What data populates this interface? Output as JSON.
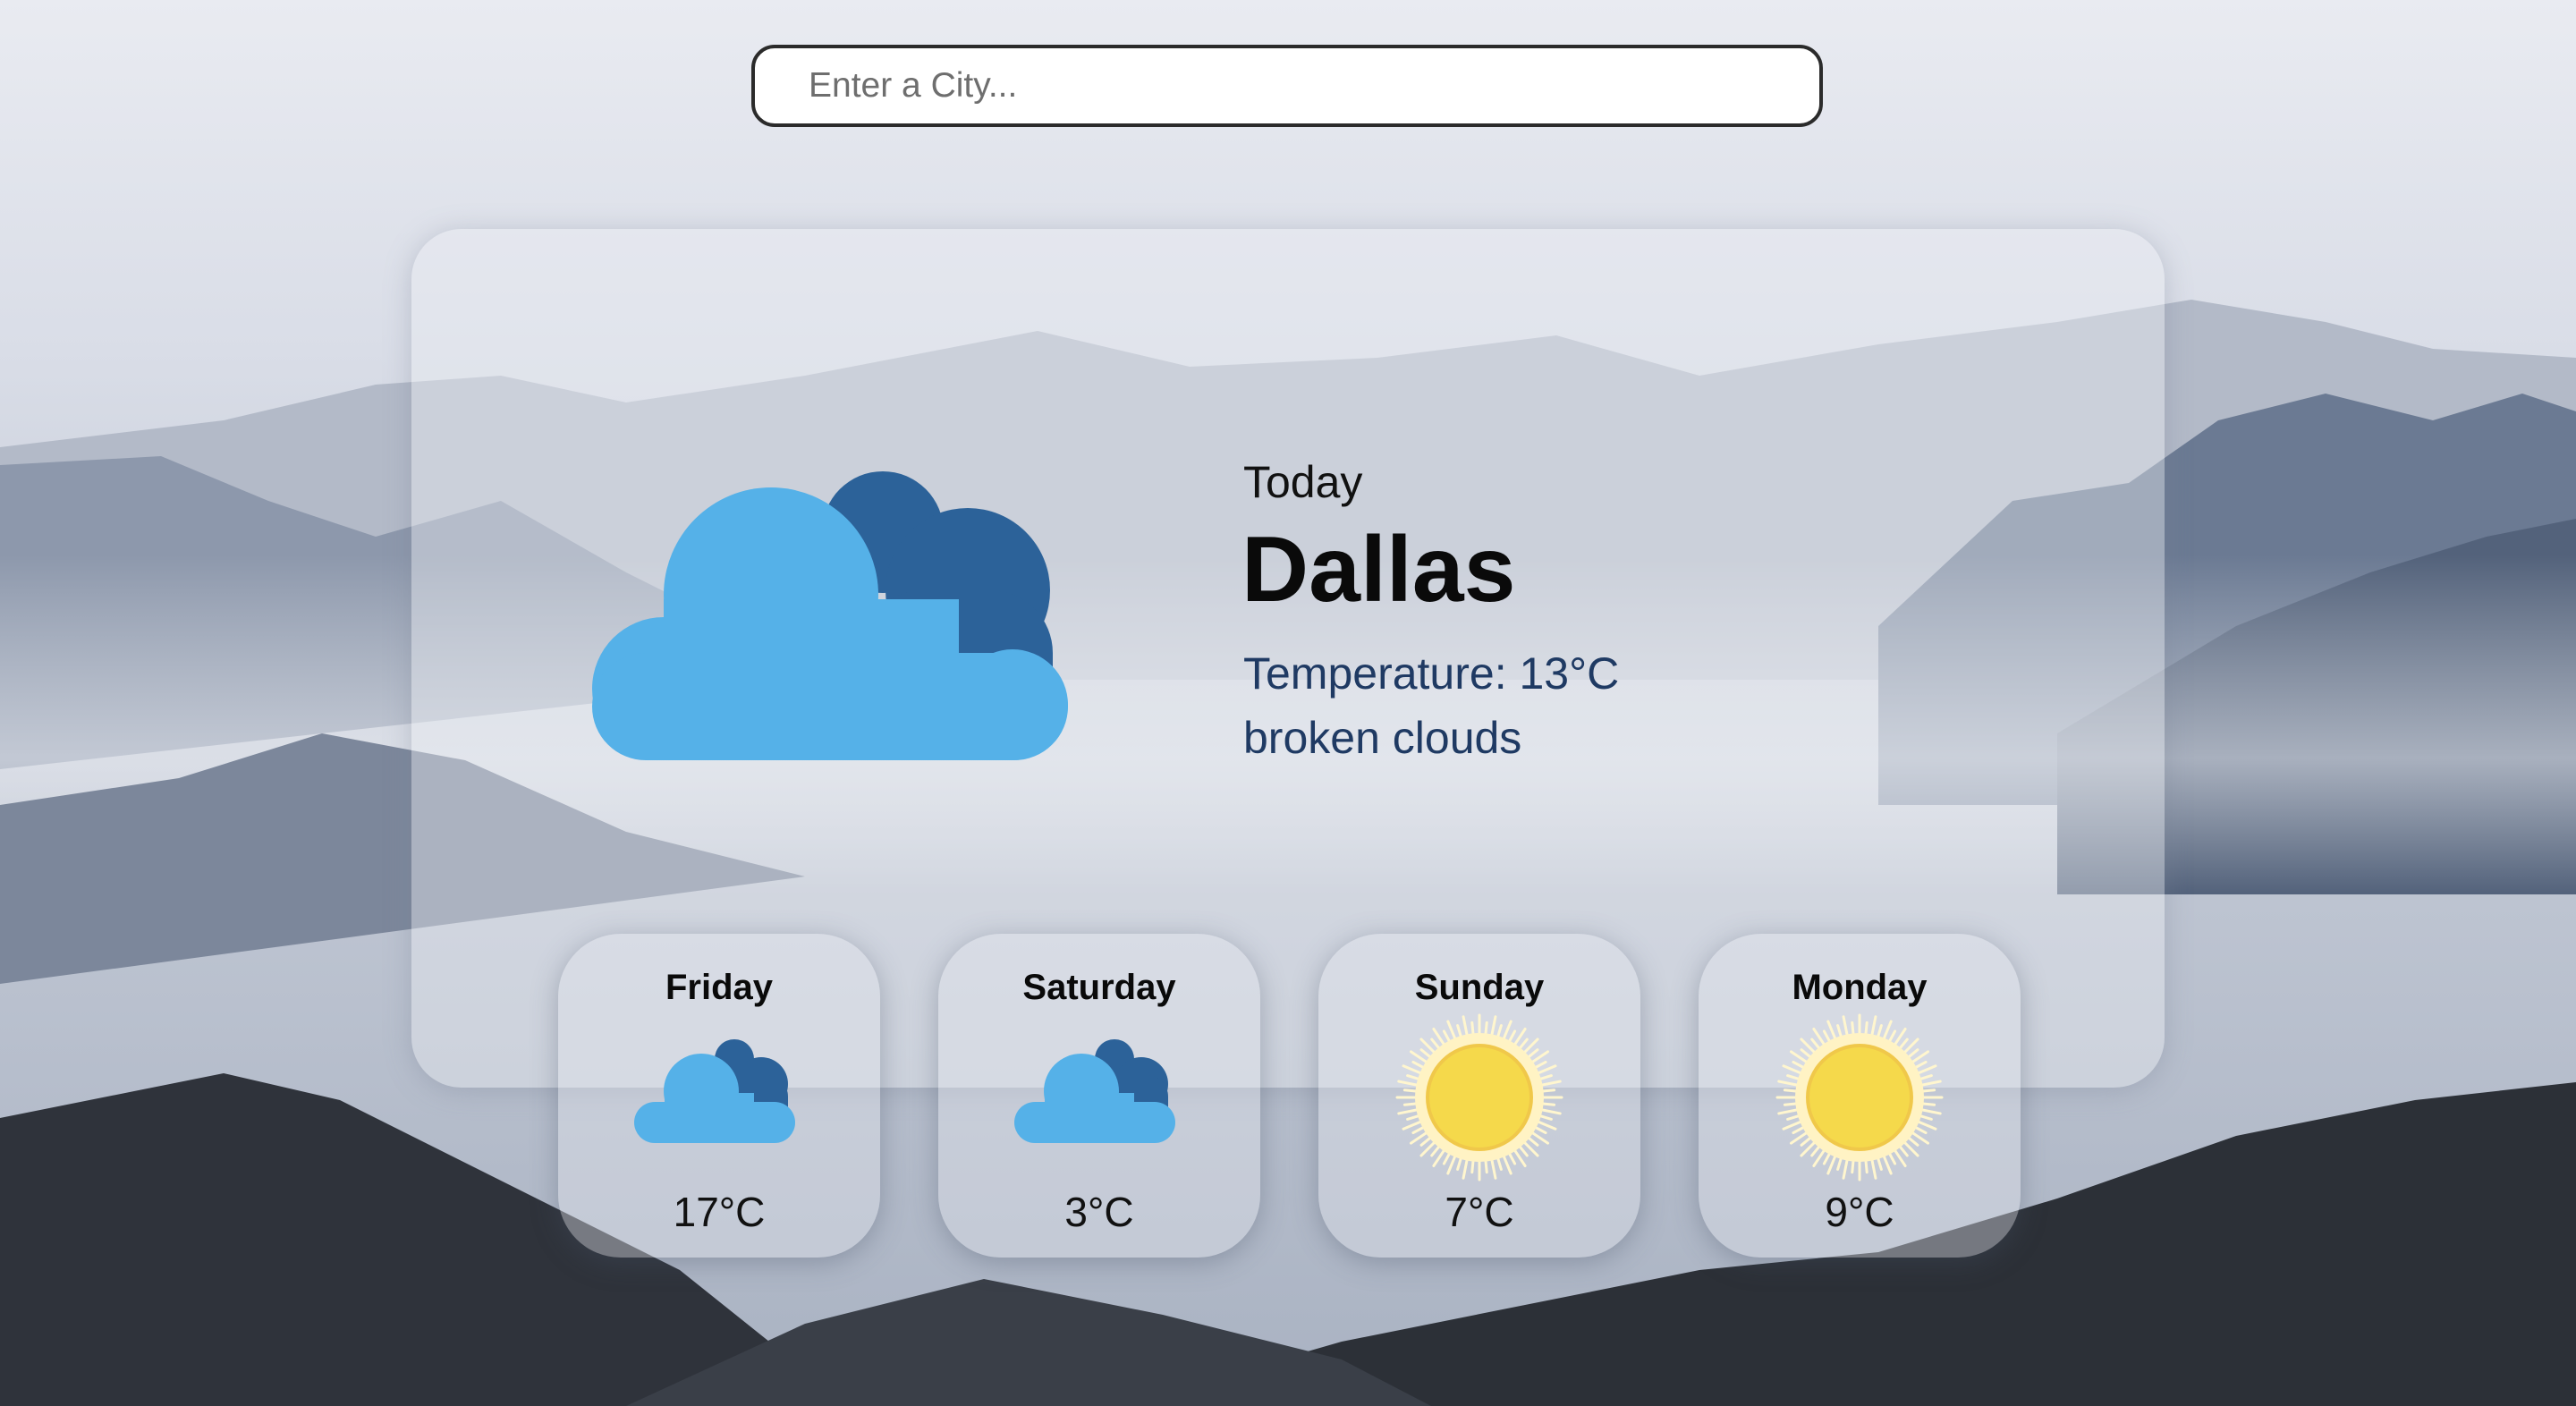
{
  "search": {
    "placeholder": "Enter a City...",
    "value": ""
  },
  "today": {
    "label": "Today",
    "city": "Dallas",
    "temperature": "Temperature: 13°C",
    "description": "broken clouds",
    "icon": "broken-clouds-icon"
  },
  "forecast": [
    {
      "day": "Friday",
      "temp": "17°C",
      "icon": "broken-clouds-icon"
    },
    {
      "day": "Saturday",
      "temp": "3°C",
      "icon": "broken-clouds-icon"
    },
    {
      "day": "Sunday",
      "temp": "7°C",
      "icon": "sun-icon"
    },
    {
      "day": "Monday",
      "temp": "9°C",
      "icon": "sun-icon"
    }
  ],
  "colors": {
    "cloud_front": "#55b1e8",
    "cloud_back": "#2c6299",
    "sun": "#f5d94b",
    "sun_rays": "#fffbe6",
    "detail_text": "#1f3a63"
  }
}
